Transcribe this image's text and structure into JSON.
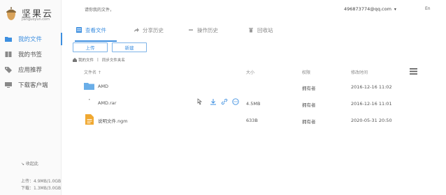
{
  "brand": {
    "title": "坚果云",
    "subtitle": "jianguoyun.com"
  },
  "header": {
    "hint": "请你我的文件，",
    "account": "496873774@qq.com",
    "account_caret": "▾",
    "lang": "En"
  },
  "sidebar": {
    "items": [
      {
        "label": "我的文件",
        "active": true
      },
      {
        "label": "我的书签",
        "active": false
      },
      {
        "label": "应用推荐",
        "active": false
      },
      {
        "label": "下载客户端",
        "active": false
      }
    ],
    "collapse_label": "↘ 收起此",
    "quota": [
      "上传：4.9MB/1.0GB",
      "下载：1.3MB/3.0GB"
    ]
  },
  "tabs": [
    {
      "label": "查看文件",
      "active": true
    },
    {
      "label": "分享历史",
      "active": false
    },
    {
      "label": "操作历史",
      "active": false
    },
    {
      "label": "回收站",
      "active": false
    }
  ],
  "toolbar": {
    "upload": "上传",
    "new": "新建"
  },
  "breadcrumb": {
    "root": "我的文件",
    "current": "同步文件夹名"
  },
  "table": {
    "columns": {
      "name": "文件名 ↑",
      "size": "大小",
      "owner": "权限",
      "modified": "修改时间"
    },
    "rows": [
      {
        "name": "AMD",
        "size": "",
        "owner": "拥有者",
        "modified": "2016-12-16 11:02",
        "type": "folder"
      },
      {
        "name": "AMD.rar",
        "size": "4.5MB",
        "owner": "拥有者",
        "modified": "2016-12-16 11:01",
        "type": "archive"
      },
      {
        "name": "说明文件.ngm",
        "size": "633B",
        "owner": "拥有者",
        "modified": "2020-05-31 20:50",
        "type": "doc"
      }
    ]
  },
  "colors": {
    "accent": "#3d8fe0",
    "folder": "#6aaee8",
    "doc": "#f0a830"
  }
}
